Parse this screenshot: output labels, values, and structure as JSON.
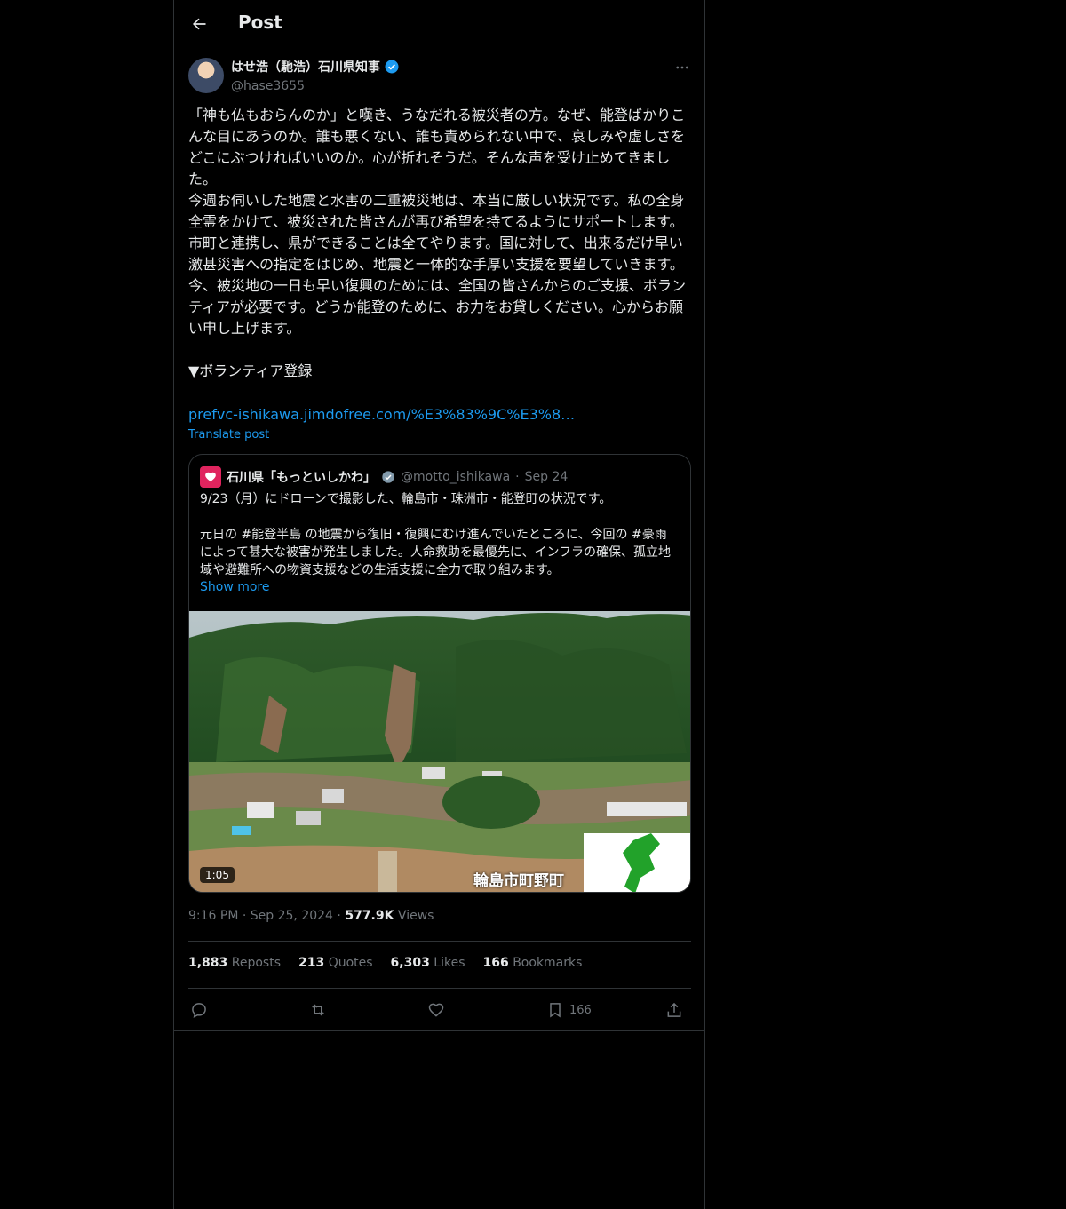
{
  "header": {
    "title": "Post"
  },
  "author": {
    "name": "はせ浩（馳浩）石川県知事",
    "handle": "@hase3655",
    "verified_color": "#1d9bf0"
  },
  "post": {
    "text": "「神も仏もおらんのか」と嘆き、うなだれる被災者の方。なぜ、能登ばかりこんな目にあうのか。誰も悪くない、誰も責められない中で、哀しみや虚しさをどこにぶつければいいのか。心が折れそうだ。そんな声を受け止めてきました。\n今週お伺いした地震と水害の二重被災地は、本当に厳しい状況です。私の全身全霊をかけて、被災された皆さんが再び希望を持てるようにサポートします。市町と連携し、県ができることは全てやります。国に対して、出来るだけ早い激甚災害への指定をはじめ、地震と一体的な手厚い支援を要望していきます。\n今、被災地の一日も早い復興のためには、全国の皆さんからのご支援、ボランティアが必要です。どうか能登のために、お力をお貸しください。心からお願い申し上げます。\n\n▼ボランティア登録",
    "link": "prefvc-ishikawa.jimdofree.com/%E3%83%9C%E3%8…",
    "translate": "Translate post"
  },
  "quote": {
    "name": "石川県「もっといしかわ」",
    "handle": "@motto_ishikawa",
    "separator": "·",
    "date": "Sep 24",
    "text": "9/23（月）にドローンで撮影した、輪島市・珠洲市・能登町の状況です。\n\n元日の #能登半島 の地震から復旧・復興にむけ進んでいたところに、今回の #豪雨 によって甚大な被害が発生しました。人命救助を最優先に、インフラの確保、孤立地域や避難所への物資支援などの生活支援に全力で取り組みます。",
    "show_more": "Show more",
    "video_duration": "1:05",
    "video_caption": "輪島市町野町"
  },
  "meta": {
    "time": "9:16 PM",
    "sep1": "·",
    "date": "Sep 25, 2024",
    "sep2": "·",
    "views_count": "577.9K",
    "views_label": "Views"
  },
  "stats": {
    "reposts_count": "1,883",
    "reposts_label": "Reposts",
    "quotes_count": "213",
    "quotes_label": "Quotes",
    "likes_count": "6,303",
    "likes_label": "Likes",
    "bookmarks_count": "166",
    "bookmarks_label": "Bookmarks"
  },
  "actions": {
    "bookmark_count": "166"
  },
  "icons": {
    "back": "arrow-left-icon",
    "more": "more-horizontal-icon",
    "reply": "reply-icon",
    "repost": "repost-icon",
    "like": "heart-icon",
    "bookmark": "bookmark-icon",
    "share": "share-icon"
  }
}
